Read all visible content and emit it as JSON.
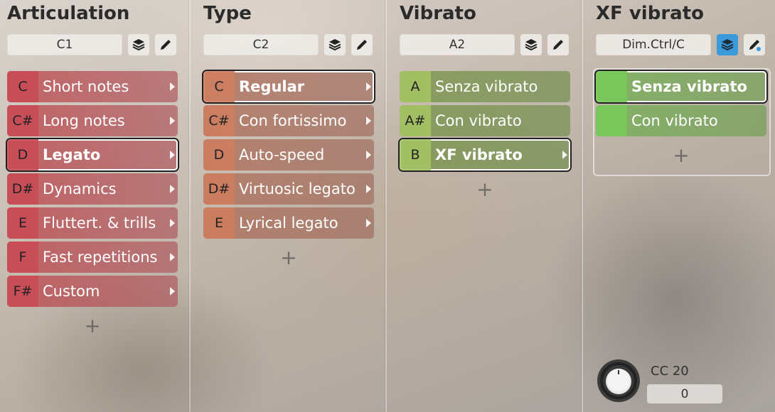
{
  "columns": [
    {
      "title": "Articulation",
      "key": "C1",
      "items": [
        {
          "key": "C",
          "label": "Short notes"
        },
        {
          "key": "C#",
          "label": "Long notes"
        },
        {
          "key": "D",
          "label": "Legato"
        },
        {
          "key": "D#",
          "label": "Dynamics"
        },
        {
          "key": "E",
          "label": "Fluttert. & trills"
        },
        {
          "key": "F",
          "label": "Fast repetitions"
        },
        {
          "key": "F#",
          "label": "Custom"
        }
      ],
      "add": "+"
    },
    {
      "title": "Type",
      "key": "C2",
      "items": [
        {
          "key": "C",
          "label": "Regular"
        },
        {
          "key": "C#",
          "label": "Con fortissimo"
        },
        {
          "key": "D",
          "label": "Auto-speed"
        },
        {
          "key": "D#",
          "label": "Virtuosic legato"
        },
        {
          "key": "E",
          "label": "Lyrical legato"
        }
      ],
      "add": "+"
    },
    {
      "title": "Vibrato",
      "key": "A2",
      "items": [
        {
          "key": "A",
          "label": "Senza vibrato"
        },
        {
          "key": "A#",
          "label": "Con vibrato"
        },
        {
          "key": "B",
          "label": "XF vibrato"
        }
      ],
      "add": "+"
    },
    {
      "title": "XF vibrato",
      "key": "Dim.Ctrl/C",
      "items": [
        {
          "key": "",
          "label": "Senza vibrato"
        },
        {
          "key": "",
          "label": "Con vibrato"
        }
      ],
      "add": "+"
    }
  ],
  "controller": {
    "label": "CC 20",
    "value": "0"
  },
  "colors": {
    "articulation": "#c05058",
    "type": "#cd7d5f",
    "vibrato": "#a5c364",
    "xf": "#78c85a",
    "active_button": "#3b9ad9"
  },
  "selection": {
    "articulation": "Legato",
    "type": "Regular",
    "vibrato": "XF vibrato",
    "xf": "Senza vibrato"
  }
}
